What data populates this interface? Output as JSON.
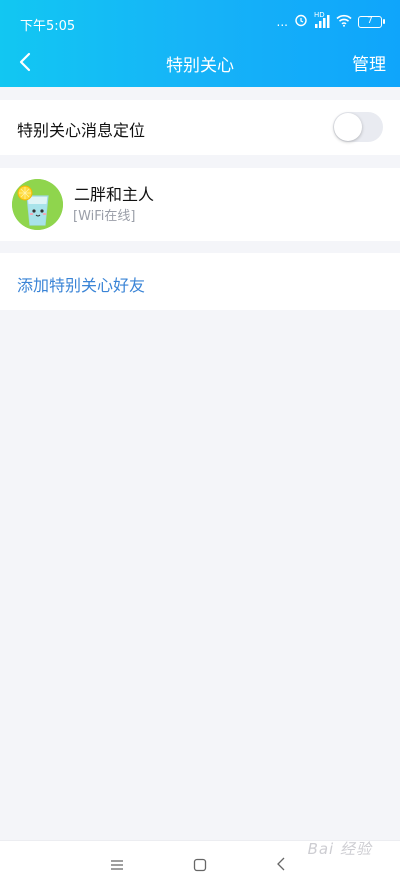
{
  "status_bar": {
    "time": "下午5:05",
    "dots": "...",
    "network": "HD",
    "battery": "7"
  },
  "navbar": {
    "title": "特别关心",
    "manage_label": "管理"
  },
  "settings": {
    "location_label": "特别关心消息定位",
    "location_enabled": false
  },
  "friends": [
    {
      "name": "二胖和主人",
      "status": "[WiFi在线]"
    }
  ],
  "add_friend_label": "添加特别关心好友",
  "watermark": "Bai 经验",
  "colors": {
    "header_start": "#12c7f2",
    "header_end": "#0fa5fb",
    "link": "#3a84d6",
    "background": "#f4f5f9"
  }
}
